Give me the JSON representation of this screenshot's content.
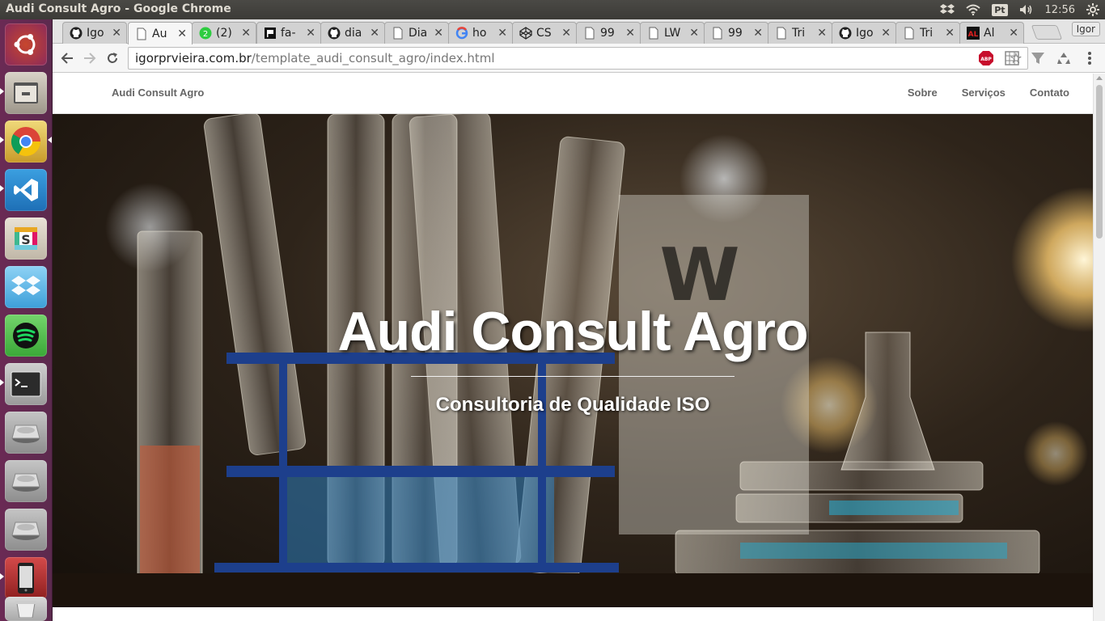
{
  "window": {
    "title": "Audi Consult Agro - Google Chrome"
  },
  "panel": {
    "language": "Pt",
    "clock": "12:56"
  },
  "launcher": {
    "items": [
      {
        "name": "ubuntu-dash-icon"
      },
      {
        "name": "files-icon"
      },
      {
        "name": "chrome-icon"
      },
      {
        "name": "vscode-icon"
      },
      {
        "name": "slack-icon"
      },
      {
        "name": "dropbox-icon"
      },
      {
        "name": "spotify-icon"
      },
      {
        "name": "terminal-icon"
      },
      {
        "name": "drive-icon"
      },
      {
        "name": "drive-icon"
      },
      {
        "name": "drive-icon"
      },
      {
        "name": "phone-icon"
      },
      {
        "name": "trash-icon"
      }
    ]
  },
  "browser": {
    "tabs": [
      {
        "title": "Igo",
        "icon": "github-icon"
      },
      {
        "title": "Au",
        "icon": "page-icon",
        "active": true
      },
      {
        "title": "(2)",
        "icon": "whatsapp-icon",
        "badge": "2"
      },
      {
        "title": "fa-",
        "icon": "flag-icon"
      },
      {
        "title": "dia",
        "icon": "github-icon"
      },
      {
        "title": "Dia",
        "icon": "page-icon"
      },
      {
        "title": "ho",
        "icon": "google-icon"
      },
      {
        "title": "CS",
        "icon": "codepen-icon"
      },
      {
        "title": "99",
        "icon": "page-icon"
      },
      {
        "title": "LW",
        "icon": "page-icon"
      },
      {
        "title": "99",
        "icon": "page-icon"
      },
      {
        "title": "Tri",
        "icon": "page-icon"
      },
      {
        "title": "Igo",
        "icon": "github-icon"
      },
      {
        "title": "Tri",
        "icon": "page-icon"
      },
      {
        "title": "Al",
        "icon": "al-icon"
      }
    ],
    "profile": "Igor",
    "url_host": "igorprvieira.com.br",
    "url_path": "/template_audi_consult_agro/index.html",
    "extensions": [
      "abp-icon",
      "grid-icon",
      "funnel-icon",
      "recycle-icon",
      "menu-icon"
    ]
  },
  "site": {
    "brand": "Audi Consult Agro",
    "nav": [
      "Sobre",
      "Serviços",
      "Contato"
    ],
    "hero_title": "Audi Consult Agro",
    "hero_subtitle": "Consultoria de Qualidade ISO"
  }
}
